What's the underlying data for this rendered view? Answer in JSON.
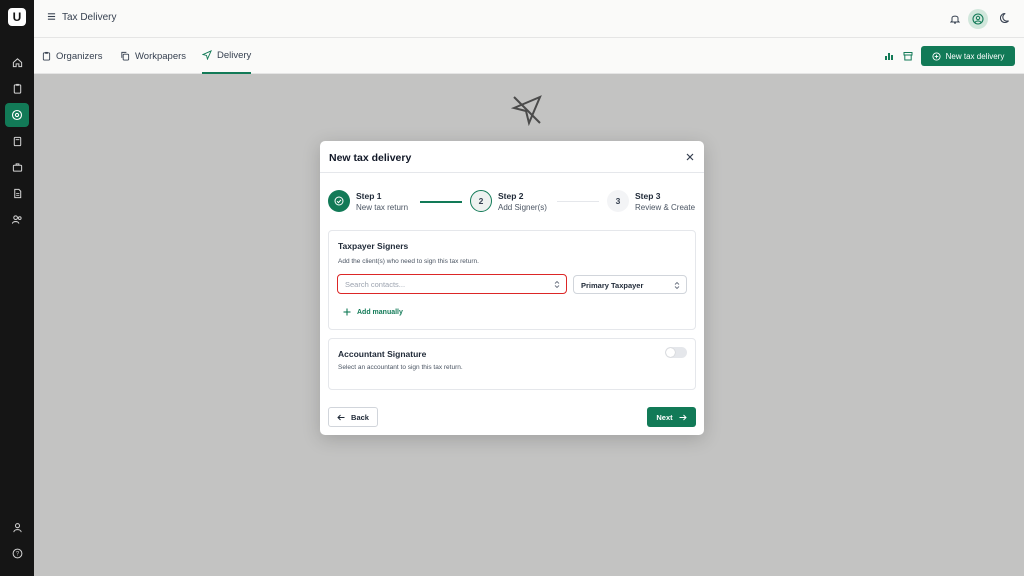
{
  "app": {
    "logo_letter": "U",
    "page_title": "Tax Delivery"
  },
  "sidebar": {
    "items": [
      {
        "icon": "home-icon"
      },
      {
        "icon": "clipboard-icon"
      },
      {
        "icon": "delivery-icon",
        "active": true
      },
      {
        "icon": "calculator-icon"
      },
      {
        "icon": "briefcase-icon"
      },
      {
        "icon": "document-icon"
      },
      {
        "icon": "users-icon"
      }
    ],
    "bottom": [
      {
        "icon": "user-icon"
      },
      {
        "icon": "help-icon"
      }
    ]
  },
  "tabs": [
    {
      "label": "Organizers",
      "icon": "clipboard-icon"
    },
    {
      "label": "Workpapers",
      "icon": "copy-icon"
    },
    {
      "label": "Delivery",
      "icon": "send-icon",
      "active": true
    }
  ],
  "toolbar": {
    "new_button_label": "New tax delivery"
  },
  "modal": {
    "title": "New tax delivery",
    "steps": [
      {
        "number": "1",
        "title": "Step 1",
        "subtitle": "New tax return",
        "state": "done"
      },
      {
        "number": "2",
        "title": "Step 2",
        "subtitle": "Add Signer(s)",
        "state": "current"
      },
      {
        "number": "3",
        "title": "Step 3",
        "subtitle": "Review & Create",
        "state": "todo"
      }
    ],
    "taxpayer": {
      "title": "Taxpayer Signers",
      "subtitle": "Add the client(s) who need to sign this tax return.",
      "search_placeholder": "Search contacts...",
      "role_value": "Primary Taxpayer",
      "add_manually": "Add manually"
    },
    "accountant": {
      "title": "Accountant Signature",
      "subtitle": "Select an accountant to sign this tax return.",
      "toggle_on": false
    },
    "back_label": "Back",
    "next_label": "Next"
  },
  "colors": {
    "brand": "#127a57",
    "error_border": "#dc2626",
    "sidebar_bg": "#151515"
  }
}
